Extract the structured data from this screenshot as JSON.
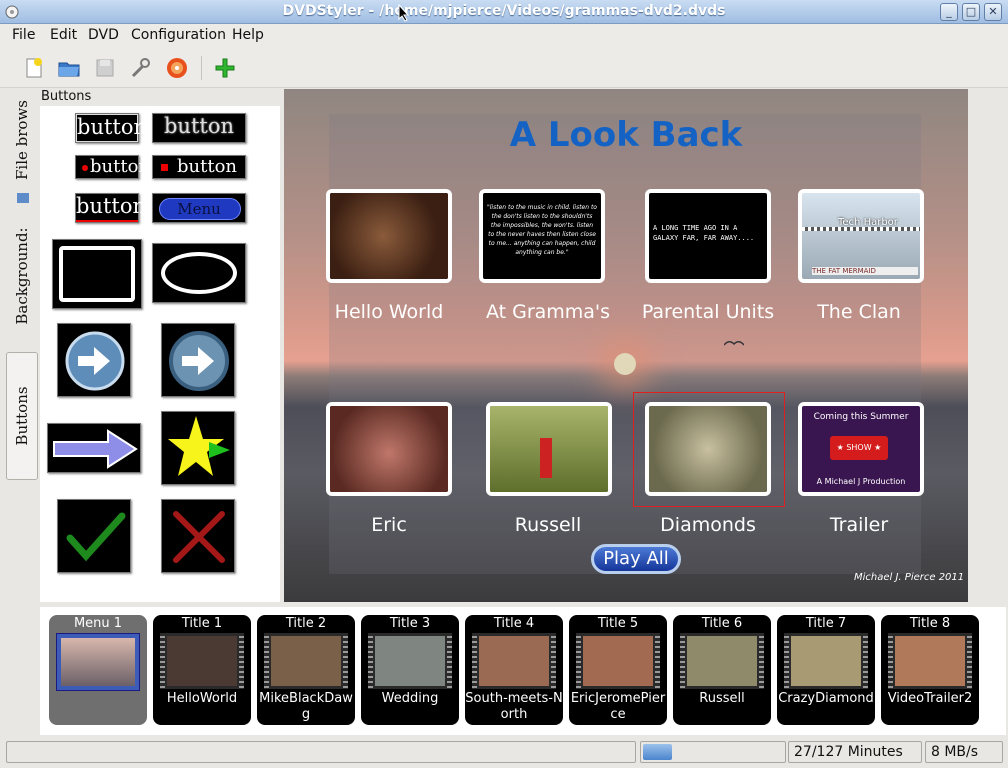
{
  "window": {
    "title": "DVDStyler - /home/mjpierce/Videos/grammas-dvd2.dvds"
  },
  "menubar": [
    "File",
    "Edit",
    "DVD",
    "Configuration",
    "Help"
  ],
  "sidetabs": {
    "file_browser": "File brows",
    "background": "Background:",
    "buttons": "Buttons"
  },
  "panel": {
    "label": "Buttons",
    "samples": {
      "button": "button",
      "menu": "Menu"
    }
  },
  "menu_preview": {
    "title": "A Look Back",
    "items": [
      {
        "caption": "Hello World"
      },
      {
        "caption": "At Gramma's",
        "thumb_text": "\"listen to the music in child. listen to the don'ts listen to the shouldn'ts the impossibles, the won'ts. listen to the never haves then listen close to me... anything can happen, child anything can be.\""
      },
      {
        "caption": "Parental Units",
        "thumb_text": "A LONG TIME AGO IN A GALAXY FAR, FAR AWAY...."
      },
      {
        "caption": "The Clan",
        "thumb_text": "Tech Harbor",
        "thumb_sign": "THE FAT MERMAID"
      },
      {
        "caption": "Eric"
      },
      {
        "caption": "Russell"
      },
      {
        "caption": "Diamonds"
      },
      {
        "caption": "Trailer",
        "thumb_top": "Coming this Summer",
        "thumb_badge": "★ SHOW ★",
        "thumb_bottom": "A Michael J Production"
      }
    ],
    "play_all": "Play All",
    "signature": "Michael J. Pierce 2011"
  },
  "titles": [
    {
      "title": "Menu 1",
      "name": ""
    },
    {
      "title": "Title 1",
      "name": "HelloWorld"
    },
    {
      "title": "Title 2",
      "name": "MikeBlackDawg"
    },
    {
      "title": "Title 3",
      "name": "Wedding"
    },
    {
      "title": "Title 4",
      "name": "South-meets-North"
    },
    {
      "title": "Title 5",
      "name": "EricJeromePierce"
    },
    {
      "title": "Title 6",
      "name": "Russell"
    },
    {
      "title": "Title 7",
      "name": "CrazyDiamond"
    },
    {
      "title": "Title 8",
      "name": "VideoTrailer2"
    }
  ],
  "status": {
    "minutes": "27/127 Minutes",
    "rate": "8 MB/s",
    "progress_fraction": 0.21
  },
  "colors": {
    "menu_title": "#1463c4",
    "selection": "#e02020",
    "titlebar": "#9fbde2"
  }
}
